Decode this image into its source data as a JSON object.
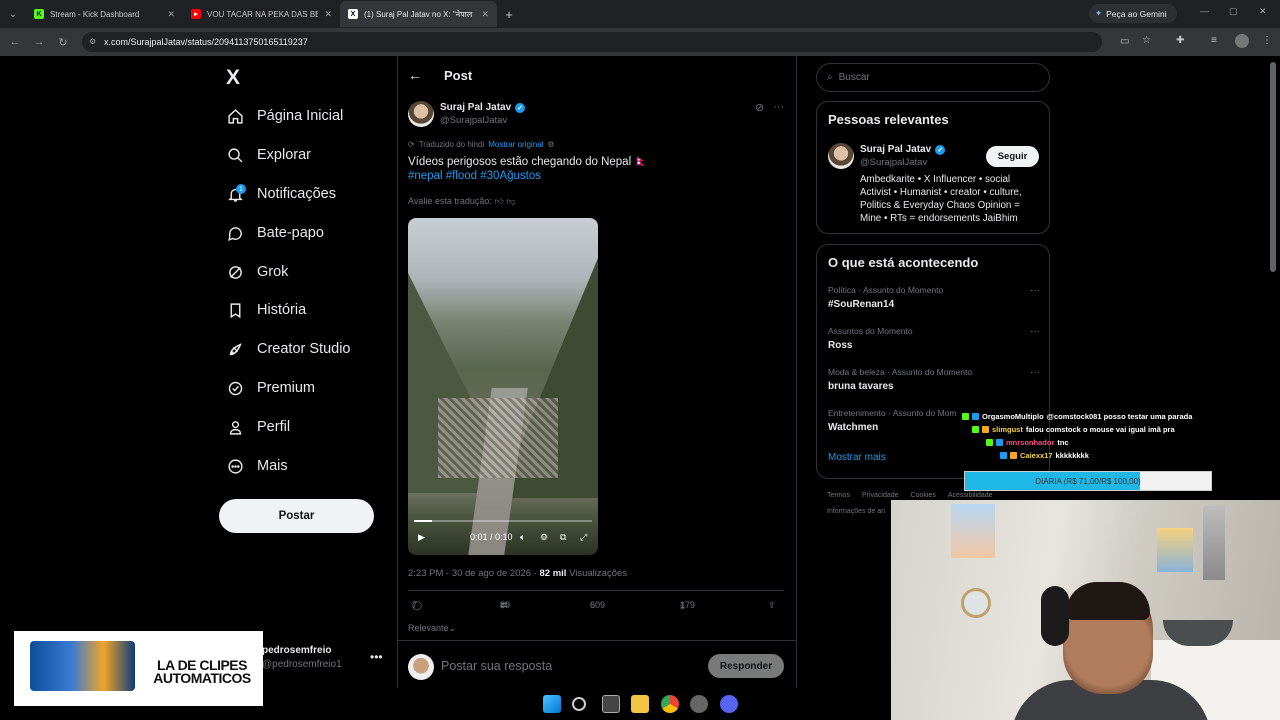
{
  "browser": {
    "tabs": [
      {
        "title": "Stream - Kick Dashboard",
        "favicon": "kick-icon",
        "color": "#53fc18"
      },
      {
        "title": "VOU TACAR NA PEKA DAS BEB!",
        "favicon": "youtube-icon",
        "color": "#ff0000"
      },
      {
        "title": "(1) Suraj Pal Jatav no X: \"नेपाल",
        "favicon": "x-icon",
        "color": "#ffffff"
      }
    ],
    "gemini_label": "Peça ao Gemini",
    "url": "x.com/SurajpalJatav/status/2094113750165119237"
  },
  "nav": {
    "logo": "X",
    "items": [
      {
        "label": "Página Inicial",
        "icon": "home-icon"
      },
      {
        "label": "Explorar",
        "icon": "search-icon"
      },
      {
        "label": "Notificações",
        "icon": "bell-icon",
        "badge": "1"
      },
      {
        "label": "Bate-papo",
        "icon": "chat-icon"
      },
      {
        "label": "Grok",
        "icon": "grok-icon"
      },
      {
        "label": "História",
        "icon": "bookmark-icon"
      },
      {
        "label": "Creator Studio",
        "icon": "rocket-icon"
      },
      {
        "label": "Premium",
        "icon": "verified-icon"
      },
      {
        "label": "Perfil",
        "icon": "person-icon"
      },
      {
        "label": "Mais",
        "icon": "more-circle-icon"
      }
    ],
    "post_button": "Postar",
    "account_name": "pedrosemfreio",
    "account_handle": "@pedrosemfreio1"
  },
  "post": {
    "header": "Post",
    "author_name": "Suraj Pal Jatav",
    "author_handle": "@SurajpalJatav",
    "translated_label": "Traduzido do hindi",
    "show_original": "Mostrar original",
    "text": "Vídeos perigosos estão chegando do Nepal 🇳🇵",
    "hashtags": "#nepal #flood #30Ağustos",
    "rate_translation": "Avalie esta tradução:",
    "video_time": "0:01 / 0:10",
    "video_progress": 0.1,
    "timestamp": "2:23 PM · 30 de ago de 2026 ·",
    "views_count": "82 mil",
    "views_label": "Visualizações",
    "replies": "7",
    "reposts": "89",
    "likes": "609",
    "bookmarks": "179",
    "sort_label": "Relevante",
    "reply_placeholder": "Postar sua resposta",
    "reply_button": "Responder"
  },
  "sidebar": {
    "search_placeholder": "Buscar",
    "relevant_title": "Pessoas relevantes",
    "relevant_name": "Suraj Pal Jatav",
    "relevant_handle": "@SurajpalJatav",
    "follow_label": "Seguir",
    "relevant_bio": "Ambedkarite • X Influencer • social Activist • Humanist • creator • culture, Politics & Everyday Chaos Opinion = Mine • RTs = endorsements JaiBhim",
    "trending_title": "O que está acontecendo",
    "trends": [
      {
        "category": "Política · Assunto do Momento",
        "name": "#SouRenan14"
      },
      {
        "category": "Assuntos do Momento",
        "name": "Ross"
      },
      {
        "category": "Moda & beleza · Assunto do Momento",
        "name": "bruna tavares"
      },
      {
        "category": "Entretenimento · Assunto do Mom",
        "name": "Watchmen"
      }
    ],
    "show_more": "Mostrar mais",
    "footer": [
      "Termos",
      "Privacidade",
      "Cookies",
      "Acessibilidade"
    ],
    "footer2": "Informações de an"
  },
  "stream_overlay": {
    "chat": [
      {
        "user": "OrgasmoMultiplo",
        "color": "#ffffff",
        "message": "@comstock081 posso testar uma parada"
      },
      {
        "user": "slimgust",
        "color": "#f5d442",
        "message": "falou comstock o mouse vai igual imã pra"
      },
      {
        "user": "mnrsonhador",
        "color": "#ff4d8a",
        "message": "tnc"
      },
      {
        "user": "Caiexx17",
        "color": "#f5d442",
        "message": "kkkkkkkk"
      }
    ],
    "goal_label": "DIÁRIA (R$ 71,00/R$ 100,00)",
    "goal_fraction": 0.71,
    "clip_banner": "LA DE CLIPES AUTOMATICOS"
  }
}
